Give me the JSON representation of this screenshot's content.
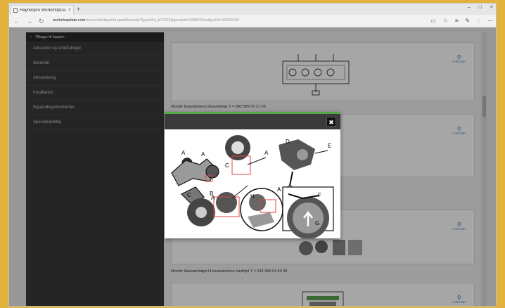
{
  "browser": {
    "tab_title": "Haynespro WorkshopDa",
    "tab_close": "×",
    "new_tab": "+",
    "window_controls": [
      "–",
      "□",
      "×"
    ],
    "url_host": "workshopdata.com",
    "url_path": "/touch/site/layout/repairManuals?typeId=t_k17923&groupId=194803&subjectId=19300300",
    "nav": {
      "back": "←",
      "forward": "→",
      "refresh": "↻"
    }
  },
  "sidebar": {
    "back_label": "Tilbage til toppen",
    "items": [
      "Advarsler og anbefalinger",
      "Generelt",
      "Afmontering",
      "Installation",
      "Ilspændingsmomenter",
      "Specialværktøj"
    ]
  },
  "content": {
    "view_full_label": "FORSTØR",
    "captions": [
      "Montér knastakslens låseværktøj X = 642 589 00 31 00",
      "Montér låseværktøjet til knastakslens tandhjul Y = 642 589 04 40 00"
    ]
  },
  "modal": {
    "close_label": "✖",
    "callouts": [
      "A",
      "A",
      "B",
      "C",
      "A",
      "D",
      "E",
      "A",
      "C",
      "H",
      "A",
      "F",
      "G"
    ]
  }
}
